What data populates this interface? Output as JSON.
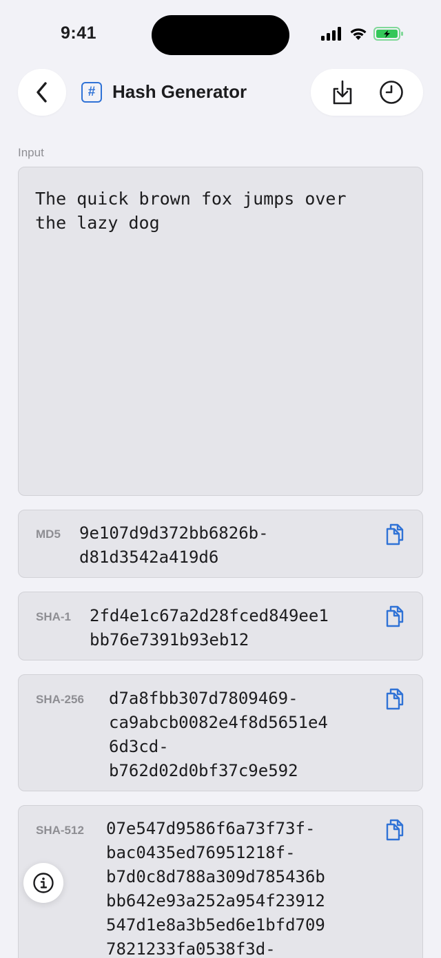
{
  "status_bar": {
    "time": "9:41"
  },
  "nav": {
    "title": "Hash Generator",
    "title_icon": "#"
  },
  "input": {
    "label": "Input",
    "value": "The quick brown fox jumps over\nthe lazy dog"
  },
  "hashes": [
    {
      "label": "MD5",
      "value": "9e107d9d372bb6826b-\nd81d3542a419d6"
    },
    {
      "label": "SHA-1",
      "value": "2fd4e1c67a2d28fced849ee1\nbb76e7391b93eb12"
    },
    {
      "label": "SHA-256",
      "value": "d7a8fbb307d7809469-\nca9abcb0082e4f8d5651e4\n6d3cd-\nb762d02d0bf37c9e592"
    },
    {
      "label": "SHA-512",
      "value": "07e547d9586f6a73f73f-\nbac0435ed76951218f-\nb7d0c8d788a309d785436b\nbb642e93a252a954f23912\n547d1e8a3b5ed6e1bfd709\n7821233fa0538f3d-"
    }
  ],
  "colors": {
    "accent": "#2f72d6",
    "background": "#f2f2f7",
    "card": "#e5e5ea",
    "battery": "#34c759"
  },
  "icons": [
    "back-chevron-icon",
    "hash-icon",
    "download-icon",
    "history-clock-icon",
    "copy-icon",
    "info-icon",
    "signal-icon",
    "wifi-icon",
    "battery-icon"
  ]
}
